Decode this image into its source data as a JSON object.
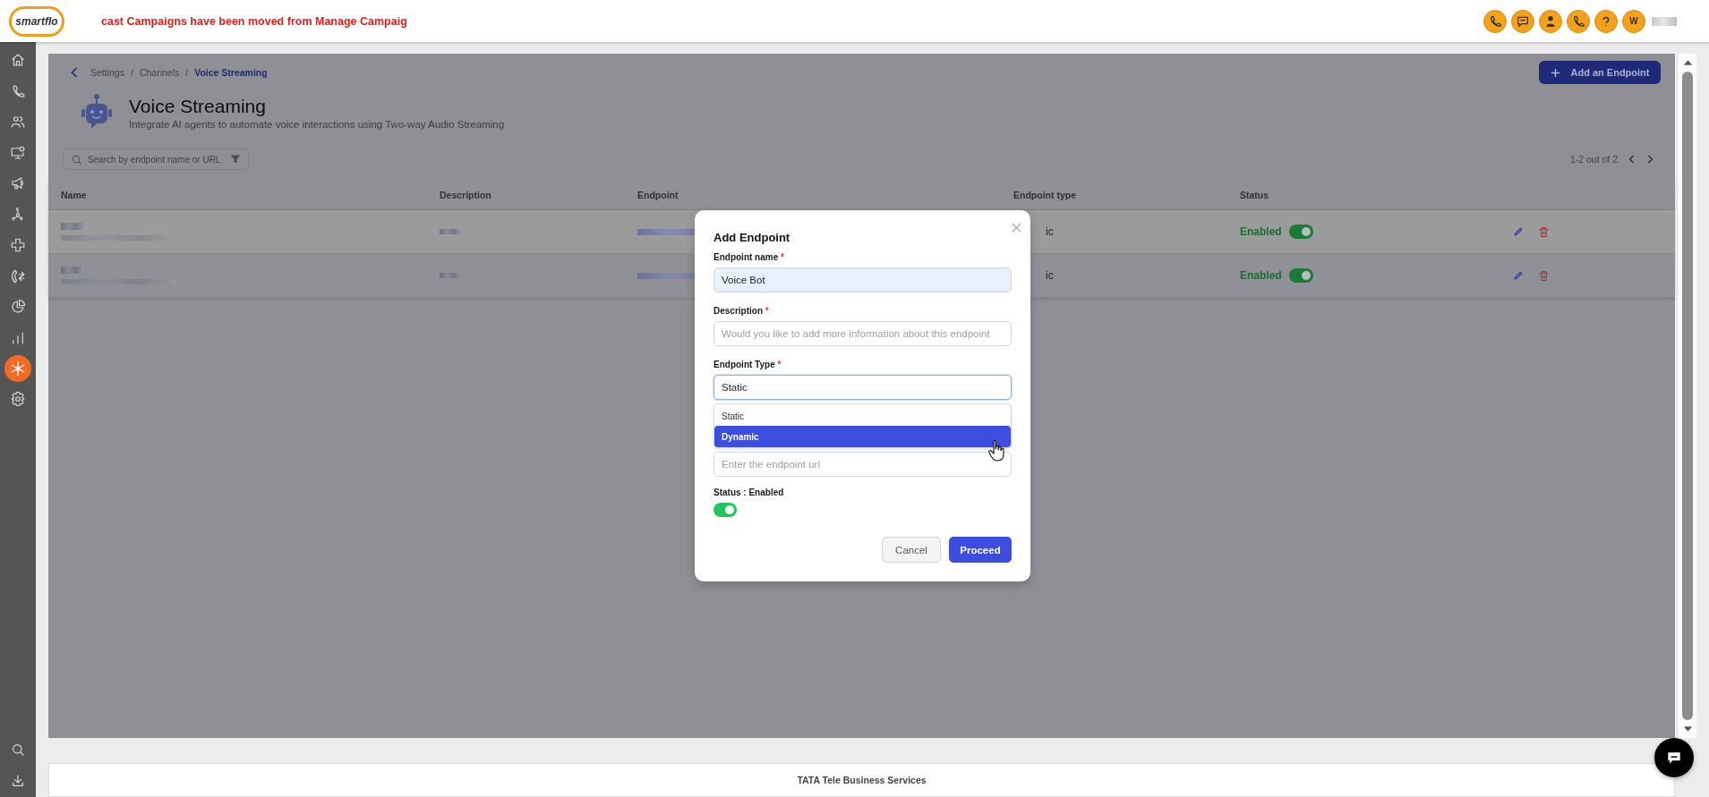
{
  "topbar": {
    "logo": "smartflo",
    "notice": "cast Campaigns have been moved from Manage Campaig",
    "avatar": "W"
  },
  "sidebar": {
    "items": [
      {
        "kind": "home",
        "selected": false
      },
      {
        "kind": "phone",
        "selected": false
      },
      {
        "kind": "users",
        "selected": false
      },
      {
        "kind": "monitor",
        "selected": false
      },
      {
        "kind": "megaphone",
        "selected": false
      },
      {
        "kind": "network",
        "selected": false
      },
      {
        "kind": "plugin",
        "selected": false
      },
      {
        "kind": "transfer",
        "selected": false
      },
      {
        "kind": "pie",
        "selected": false
      },
      {
        "kind": "bars",
        "selected": false
      },
      {
        "kind": "hub",
        "selected": true
      },
      {
        "kind": "gear",
        "selected": false
      }
    ],
    "bottom_items": [
      {
        "kind": "search",
        "selected": false
      },
      {
        "kind": "download",
        "selected": false
      }
    ]
  },
  "breadcrumb": {
    "items": [
      "Settings",
      "Channels",
      "Voice Streaming"
    ],
    "separator": "/"
  },
  "add_button": "Add an Endpoint",
  "page": {
    "title": "Voice Streaming",
    "subtitle": "Integrate AI agents to automate voice interactions using Two-way Audio Streaming"
  },
  "search": {
    "placeholder": "Search by endpoint name or URL"
  },
  "pagination": "1-2 out of 2",
  "table": {
    "columns": [
      "Name",
      "Description",
      "Endpoint",
      "Endpoint type",
      "Status"
    ],
    "rows": [
      {
        "hovered": true,
        "endpoint_type": "ic",
        "status": "Enabled",
        "enabled": true
      },
      {
        "hovered": false,
        "endpoint_type": "ic",
        "status": "Enabled",
        "enabled": true
      }
    ]
  },
  "modal": {
    "title": "Add Endpoint",
    "fields": [
      {
        "label": "Endpoint name",
        "marker": "*",
        "value": "Voice Bot",
        "focused": false
      },
      {
        "label": "Description",
        "marker": "*",
        "placeholder": "Would you like to add more information about this endpoint",
        "focused": false
      },
      {
        "label": "Endpoint Type",
        "marker": "*",
        "value": "Static",
        "focused": true
      }
    ],
    "options": [
      {
        "label": "Static",
        "selected": false
      },
      {
        "label": "Dynamic",
        "selected": true
      }
    ],
    "url_placeholder": "Enter the endpoint url",
    "status_label": "Status : Enabled",
    "status_on": true,
    "buttons": [
      "Cancel",
      "Proceed"
    ]
  },
  "footer": "TATA Tele Business Services"
}
